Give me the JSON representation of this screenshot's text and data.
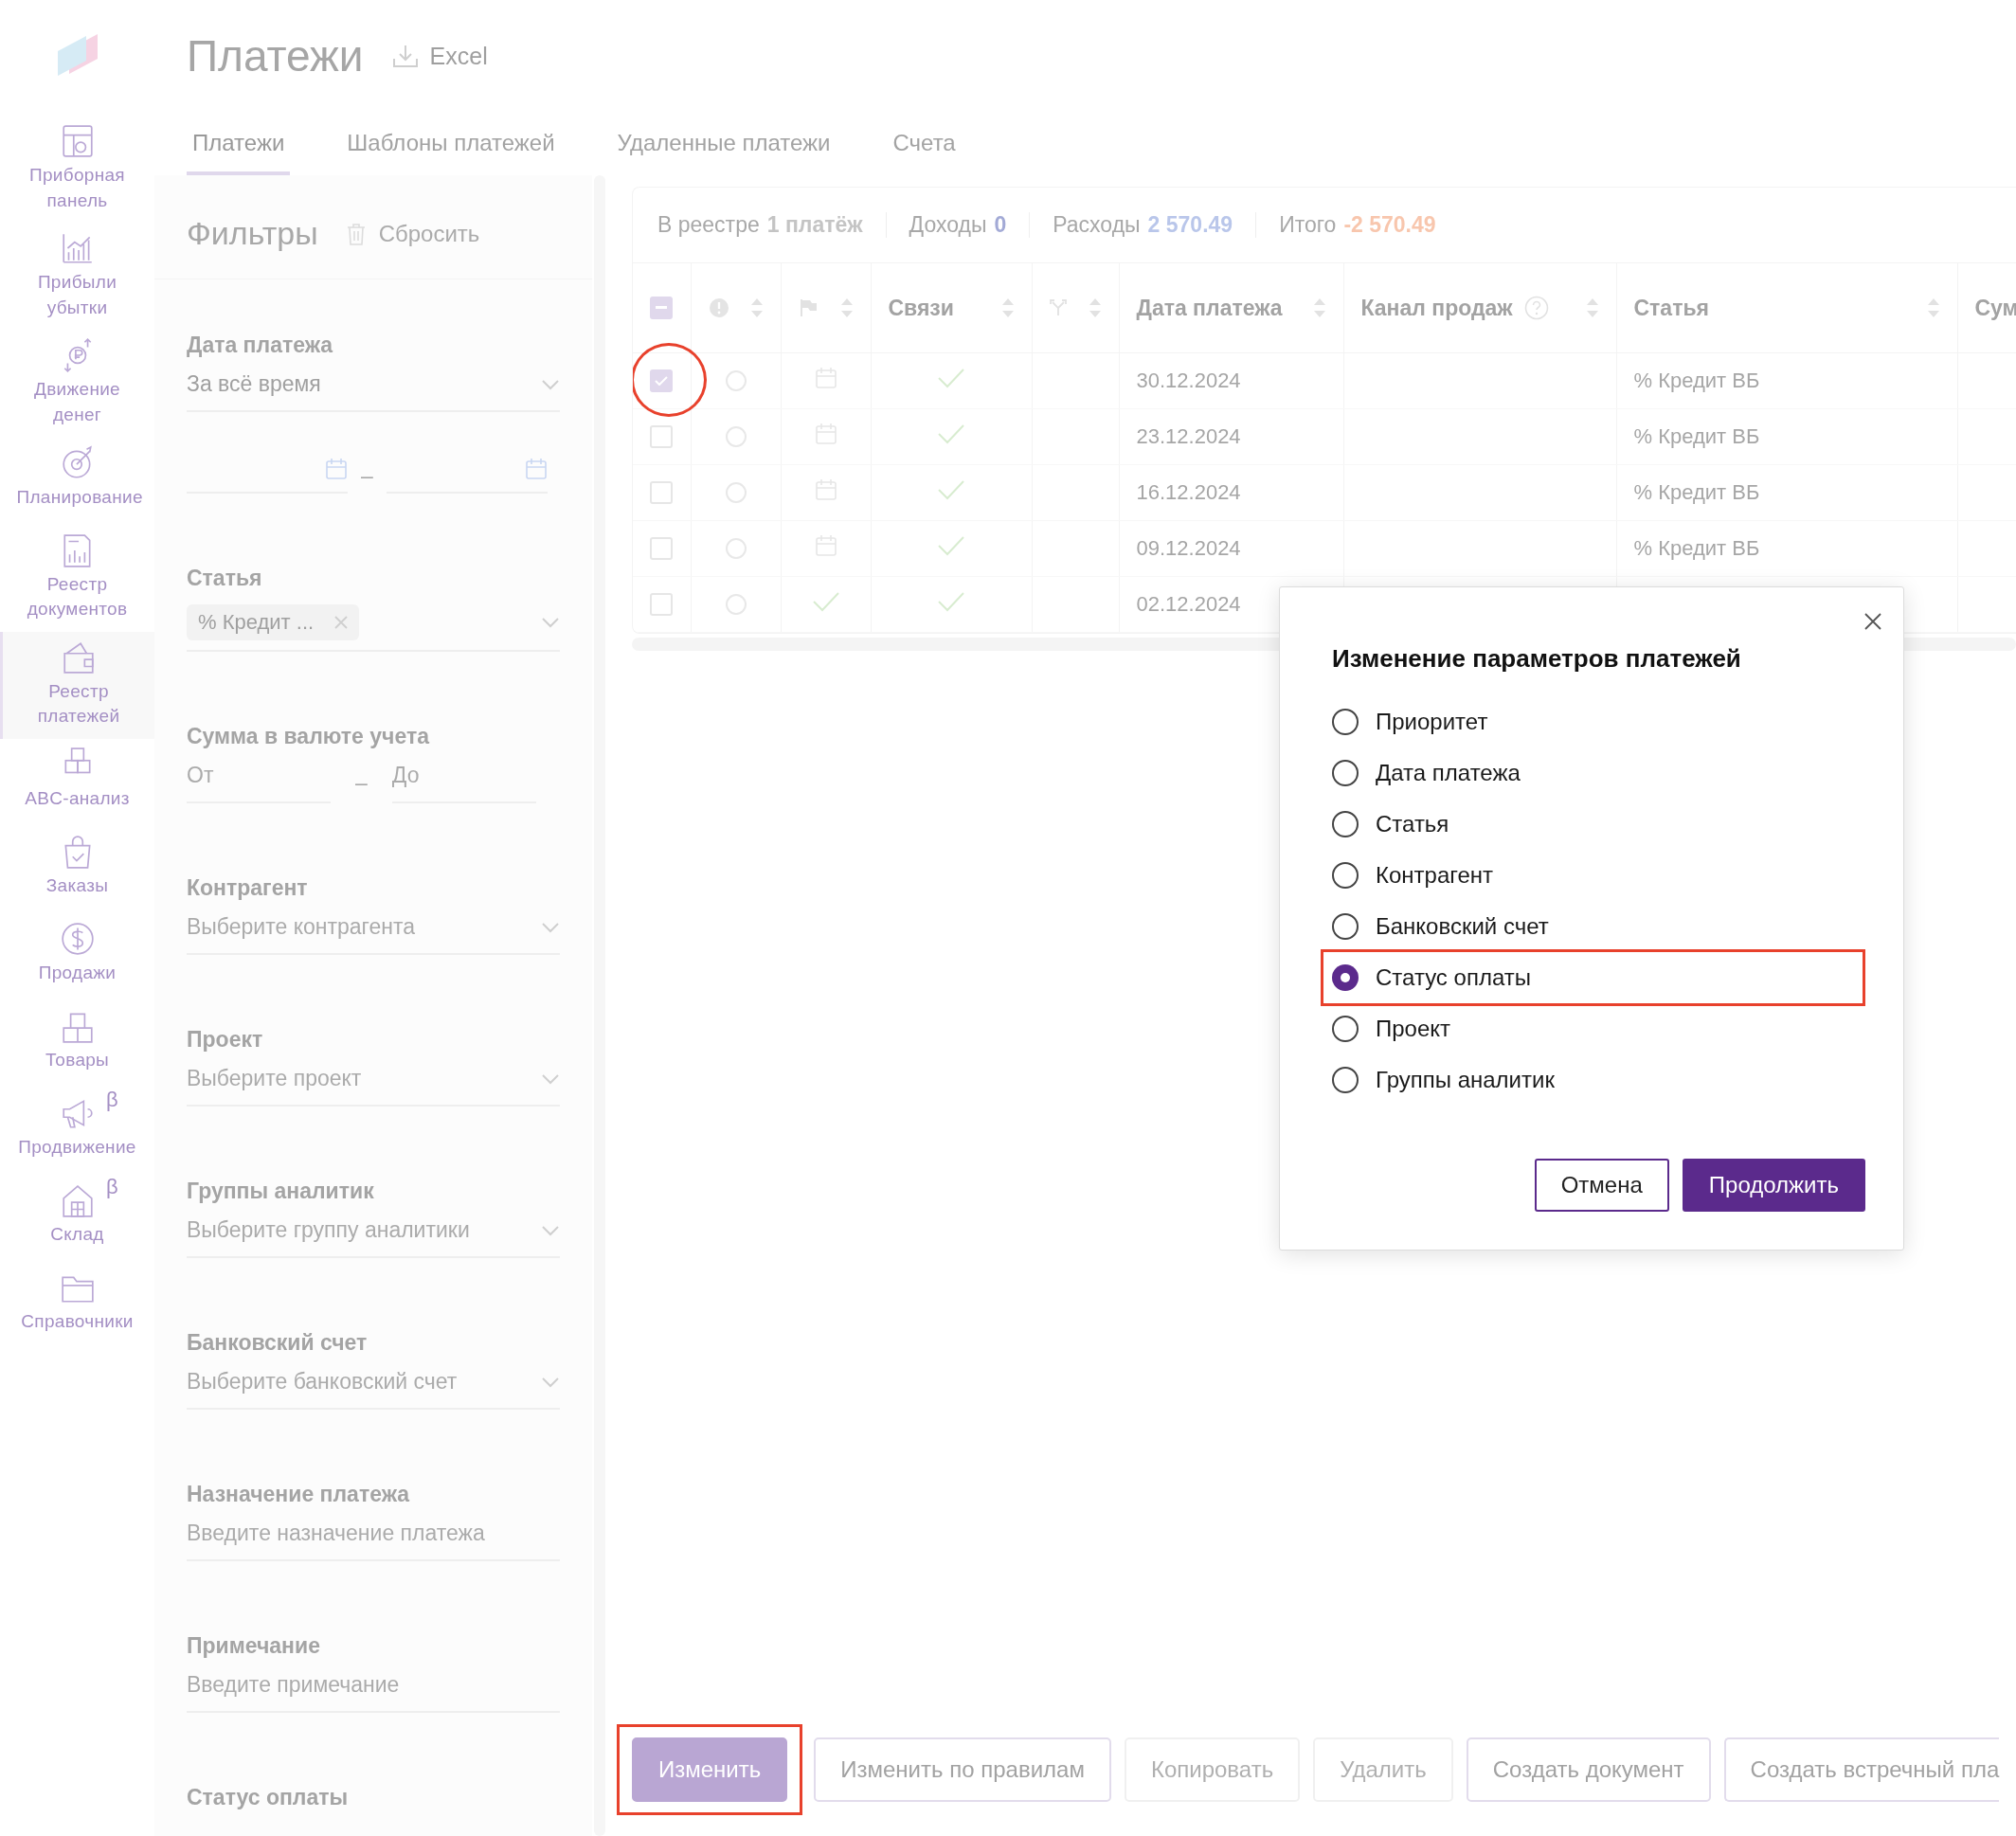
{
  "nav": {
    "items": [
      {
        "label": "Приборная панель",
        "selected": false
      },
      {
        "label": "Прибыли убытки",
        "selected": false
      },
      {
        "label": "Движение денег",
        "selected": false
      },
      {
        "label": "Планирование",
        "selected": false
      },
      {
        "label": "Реестр документов",
        "selected": false
      },
      {
        "label": "Реестр платежей",
        "selected": true
      },
      {
        "label": "ABC-анализ",
        "selected": false
      },
      {
        "label": "Заказы",
        "selected": false
      },
      {
        "label": "Продажи",
        "selected": false
      },
      {
        "label": "Товары",
        "selected": false
      },
      {
        "label": "Продвижение",
        "selected": false,
        "beta_mark": "β"
      },
      {
        "label": "Склад",
        "selected": false,
        "beta_mark": "β"
      },
      {
        "label": "Справочники",
        "selected": false
      }
    ]
  },
  "header": {
    "title": "Платежи",
    "export": "Excel"
  },
  "tabs": [
    {
      "label": "Платежи",
      "selected": true
    },
    {
      "label": "Шаблоны платежей",
      "selected": false
    },
    {
      "label": "Удаленные платежи",
      "selected": false
    },
    {
      "label": "Счета",
      "selected": false
    }
  ],
  "filters": {
    "title": "Фильтры",
    "reset": "Сбросить",
    "fields": [
      {
        "kind": "select",
        "label": "Дата платежа",
        "value": "За всё время"
      },
      {
        "kind": "date-range",
        "separator": "–"
      },
      {
        "kind": "tags",
        "label": "Статья",
        "tags": [
          "% Кредит ..."
        ]
      },
      {
        "kind": "range",
        "label": "Сумма в валюте учета",
        "from_placeholder": "От",
        "to_placeholder": "До",
        "separator": "–"
      },
      {
        "kind": "select",
        "label": "Контрагент",
        "placeholder": "Выберите контрагента"
      },
      {
        "kind": "select",
        "label": "Проект",
        "placeholder": "Выберите проект"
      },
      {
        "kind": "select",
        "label": "Группы аналитик",
        "placeholder": "Выберите группу аналитики"
      },
      {
        "kind": "select",
        "label": "Банковский счет",
        "placeholder": "Выберите банковский счет"
      },
      {
        "kind": "text",
        "label": "Назначение платежа",
        "placeholder": "Введите назначение платежа"
      },
      {
        "kind": "text",
        "label": "Примечание",
        "placeholder": "Введите примечание"
      },
      {
        "kind": "heading",
        "label": "Статус оплаты"
      }
    ]
  },
  "summary": [
    {
      "label": "В реестре",
      "value": "1 платёж",
      "color": "#c4c4c4"
    },
    {
      "label": "Доходы",
      "value": "0",
      "color": "#a3aad6"
    },
    {
      "label": "Расходы",
      "value": "2 570.49",
      "color": "#b9c6ea"
    },
    {
      "label": "Итого",
      "value": "-2 570.49",
      "color": "#f8c6ad"
    }
  ],
  "table": {
    "select_all": {
      "partial": true
    },
    "columns": [
      "Связи",
      "Дата платежа",
      "Канал продаж",
      "Статья",
      "Сум"
    ],
    "rows": [
      {
        "selected": true,
        "highlighted": true,
        "priority": false,
        "flag_done": false,
        "date": "30.12.2024",
        "article": "% Кредит ВБ"
      },
      {
        "selected": false,
        "highlighted": false,
        "priority": false,
        "flag_done": false,
        "date": "23.12.2024",
        "article": "% Кредит ВБ"
      },
      {
        "selected": false,
        "highlighted": false,
        "priority": false,
        "flag_done": false,
        "date": "16.12.2024",
        "article": "% Кредит ВБ"
      },
      {
        "selected": false,
        "highlighted": false,
        "priority": false,
        "flag_done": false,
        "date": "09.12.2024",
        "article": "% Кредит ВБ"
      },
      {
        "selected": false,
        "highlighted": false,
        "priority": false,
        "flag_done": true,
        "date": "02.12.2024"
      }
    ]
  },
  "actions": [
    {
      "label": "Изменить",
      "kind": "primary",
      "disabled": false,
      "highlighted": true
    },
    {
      "label": "Изменить по правилам",
      "kind": "outline",
      "disabled": false,
      "highlighted": false
    },
    {
      "label": "Копировать",
      "kind": "outline",
      "disabled": true,
      "highlighted": false
    },
    {
      "label": "Удалить",
      "kind": "outline",
      "disabled": true,
      "highlighted": false
    },
    {
      "label": "Создать документ",
      "kind": "outline",
      "disabled": false,
      "highlighted": false
    },
    {
      "label": "Создать встречный пла",
      "kind": "outline",
      "disabled": false,
      "highlighted": false
    }
  ],
  "dialog": {
    "title": "Изменение параметров платежей",
    "options": [
      {
        "label": "Приоритет",
        "selected": false,
        "highlighted": false
      },
      {
        "label": "Дата платежа",
        "selected": false,
        "highlighted": false
      },
      {
        "label": "Статья",
        "selected": false,
        "highlighted": false
      },
      {
        "label": "Контрагент",
        "selected": false,
        "highlighted": false
      },
      {
        "label": "Банковский счет",
        "selected": false,
        "highlighted": false
      },
      {
        "label": "Статус оплаты",
        "selected": true,
        "highlighted": true
      },
      {
        "label": "Проект",
        "selected": false,
        "highlighted": false
      },
      {
        "label": "Группы аналитик",
        "selected": false,
        "highlighted": false
      }
    ],
    "cancel": "Отмена",
    "confirm": "Продолжить"
  }
}
